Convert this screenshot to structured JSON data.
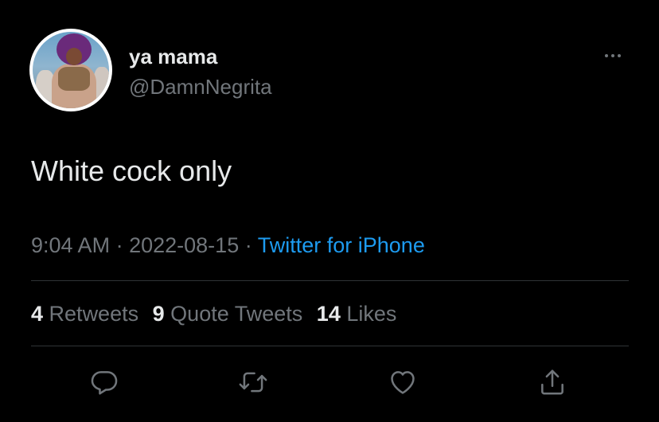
{
  "user": {
    "display_name": "ya mama",
    "handle": "@DamnNegrita"
  },
  "tweet": {
    "text": "White cock only"
  },
  "meta": {
    "time": "9:04 AM",
    "separator": "·",
    "date": "2022-08-15",
    "source": "Twitter for iPhone"
  },
  "stats": {
    "retweets_count": "4",
    "retweets_label": "Retweets",
    "quotes_count": "9",
    "quotes_label": "Quote Tweets",
    "likes_count": "14",
    "likes_label": "Likes"
  },
  "icons": {
    "more": "more-horizontal-icon",
    "reply": "reply-icon",
    "retweet": "retweet-icon",
    "like": "heart-icon",
    "share": "share-icon"
  },
  "colors": {
    "background": "#000000",
    "primary_text": "#e7e9ea",
    "secondary_text": "#71767b",
    "link": "#1d9bf0",
    "divider": "#2f3336"
  }
}
